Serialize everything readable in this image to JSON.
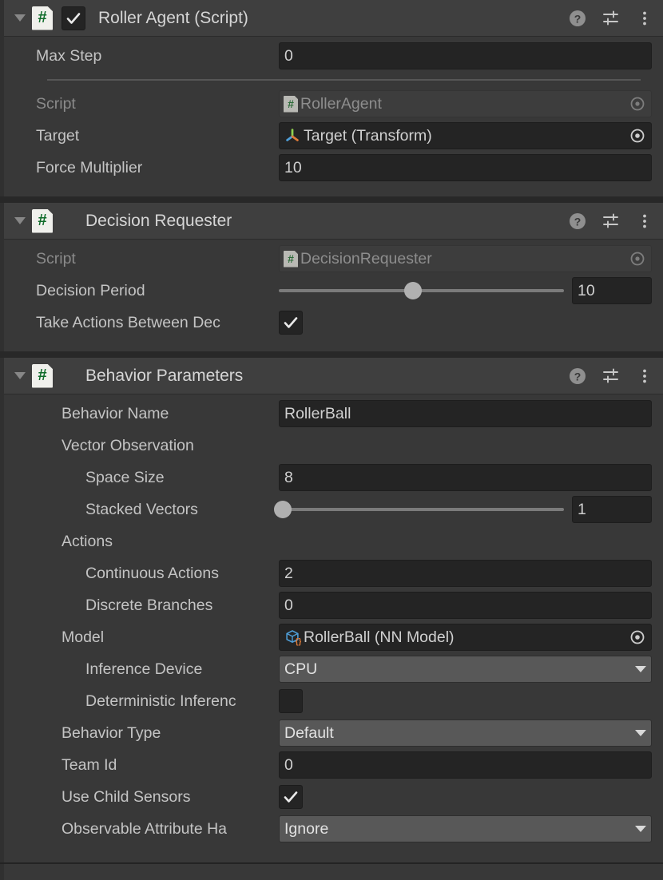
{
  "components": [
    {
      "id": "roller-agent",
      "title": "Roller Agent (Script)",
      "icon": "csharp-script-icon",
      "enabled_checkbox": true,
      "foldout": "expanded",
      "header_icons": [
        "help-icon",
        "preset-icon",
        "more-menu-icon"
      ],
      "fields": {
        "max_step_label": "Max Step",
        "max_step_value": "0",
        "script_label": "Script",
        "script_value": "RollerAgent",
        "target_label": "Target",
        "target_value": "Target (Transform)",
        "force_multiplier_label": "Force Multiplier",
        "force_multiplier_value": "10"
      }
    },
    {
      "id": "decision-requester",
      "title": "Decision Requester",
      "icon": "csharp-script-icon",
      "foldout": "expanded",
      "header_icons": [
        "help-icon",
        "preset-icon",
        "more-menu-icon"
      ],
      "fields": {
        "script_label": "Script",
        "script_value": "DecisionRequester",
        "decision_period_label": "Decision Period",
        "decision_period_value": "10",
        "decision_period_slider_percent": 47,
        "take_actions_label": "Take Actions Between Dec",
        "take_actions_checked": true
      }
    },
    {
      "id": "behavior-parameters",
      "title": "Behavior Parameters",
      "icon": "csharp-script-icon",
      "foldout": "expanded",
      "header_icons": [
        "help-icon",
        "preset-icon",
        "more-menu-icon"
      ],
      "fields": {
        "behavior_name_label": "Behavior Name",
        "behavior_name_value": "RollerBall",
        "vector_observation_label": "Vector Observation",
        "space_size_label": "Space Size",
        "space_size_value": "8",
        "stacked_vectors_label": "Stacked Vectors",
        "stacked_vectors_value": "1",
        "stacked_vectors_slider_percent": 1,
        "actions_label": "Actions",
        "continuous_actions_label": "Continuous Actions",
        "continuous_actions_value": "2",
        "discrete_branches_label": "Discrete Branches",
        "discrete_branches_value": "0",
        "model_label": "Model",
        "model_value": "RollerBall (NN Model)",
        "inference_device_label": "Inference Device",
        "inference_device_value": "CPU",
        "deterministic_inference_label": "Deterministic Inferenc",
        "deterministic_inference_checked": false,
        "behavior_type_label": "Behavior Type",
        "behavior_type_value": "Default",
        "team_id_label": "Team Id",
        "team_id_value": "0",
        "use_child_sensors_label": "Use Child Sensors",
        "use_child_sensors_checked": true,
        "observable_attribute_label": "Observable Attribute Ha",
        "observable_attribute_value": "Ignore"
      }
    }
  ],
  "colors": {
    "panel_bg": "#383838",
    "header_bg": "#3f3f3f",
    "input_bg": "#242424",
    "dropdown_bg": "#585858",
    "text": "#c4c4c4",
    "text_dim": "#8a8a8a",
    "script_icon_green": "#0f6b2a",
    "nn_icon_blue": "#4f9fd8",
    "nn_icon_orange": "#e07b39"
  }
}
